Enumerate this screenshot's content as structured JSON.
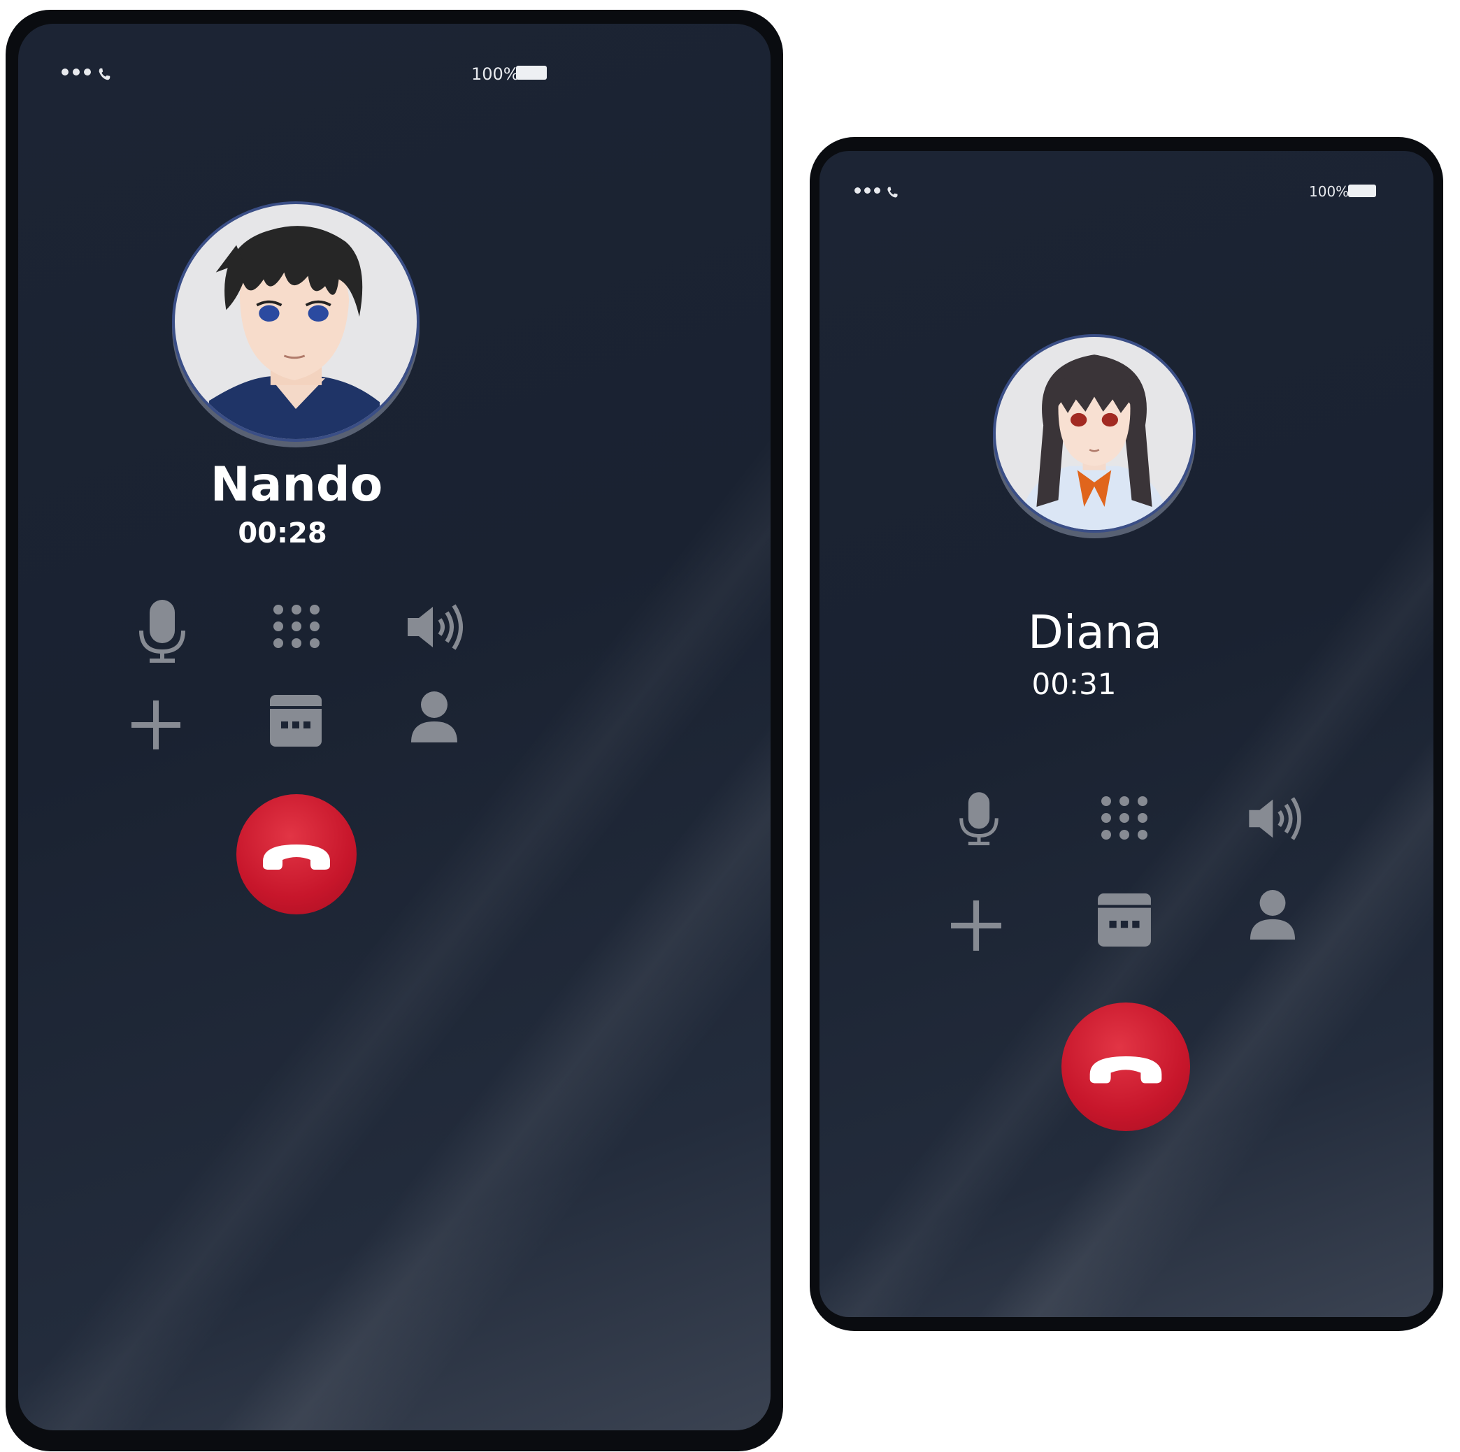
{
  "calls": [
    {
      "caller_name": "Nando",
      "duration": "00:28",
      "battery_text": "100%",
      "avatar": "anime-boy-avatar"
    },
    {
      "caller_name": "Diana",
      "duration": "00:31",
      "battery_text": "100%",
      "avatar": "anime-girl-avatar"
    }
  ],
  "controls": [
    "microphone-icon",
    "keypad-icon",
    "speaker-icon",
    "add-call-icon",
    "hold-icon",
    "contacts-icon"
  ],
  "colors": {
    "screen_bg": "#1c2434",
    "icon_gray": "#878b93",
    "end_call_red": "#c7162b",
    "avatar_border": "#3a4e86"
  }
}
